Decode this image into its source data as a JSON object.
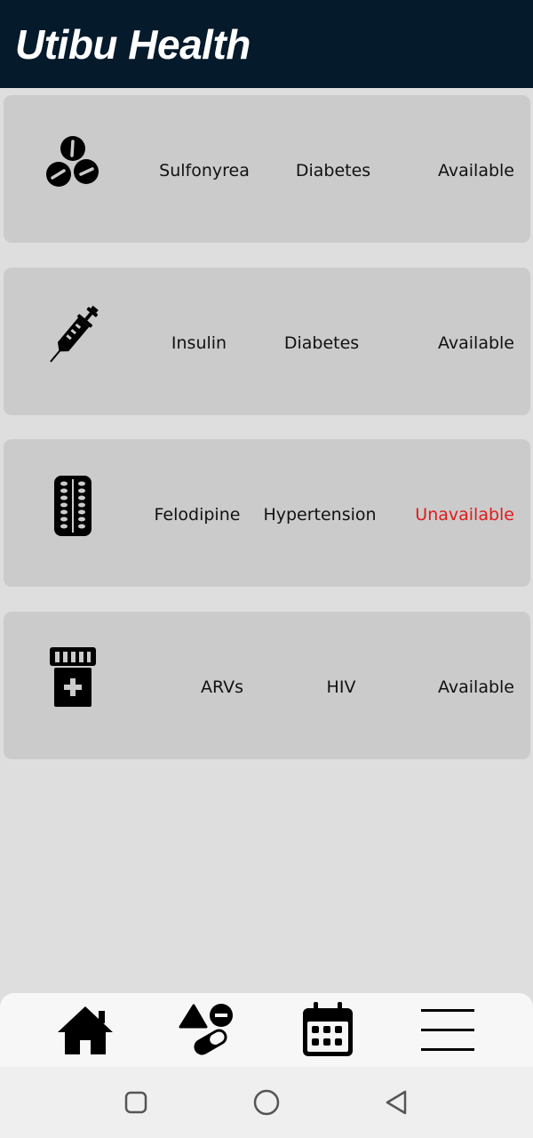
{
  "app": {
    "title": "Utibu Health"
  },
  "colors": {
    "header_bg": "#051a2b",
    "page_bg": "#dedede",
    "card_bg": "#cbcbcb",
    "available_text": "#111111",
    "unavailable_text": "#e01b1b"
  },
  "medications": [
    {
      "icon": "pills-icon",
      "name": "Sulfonyrea",
      "condition": "Diabetes",
      "status": "Available"
    },
    {
      "icon": "syringe-icon",
      "name": "Insulin",
      "condition": "Diabetes",
      "status": "Available"
    },
    {
      "icon": "blister-pack-icon",
      "name": "Felodipine",
      "condition": "Hypertension",
      "status": "Unavailable"
    },
    {
      "icon": "pill-bottle-icon",
      "name": "ARVs",
      "condition": "HIV",
      "status": "Available"
    }
  ],
  "bottom_nav": [
    {
      "icon": "home-icon"
    },
    {
      "icon": "medications-icon"
    },
    {
      "icon": "calendar-icon"
    },
    {
      "icon": "menu-icon"
    }
  ],
  "system_nav": [
    {
      "icon": "recents-icon"
    },
    {
      "icon": "home-circle-icon"
    },
    {
      "icon": "back-icon"
    }
  ]
}
